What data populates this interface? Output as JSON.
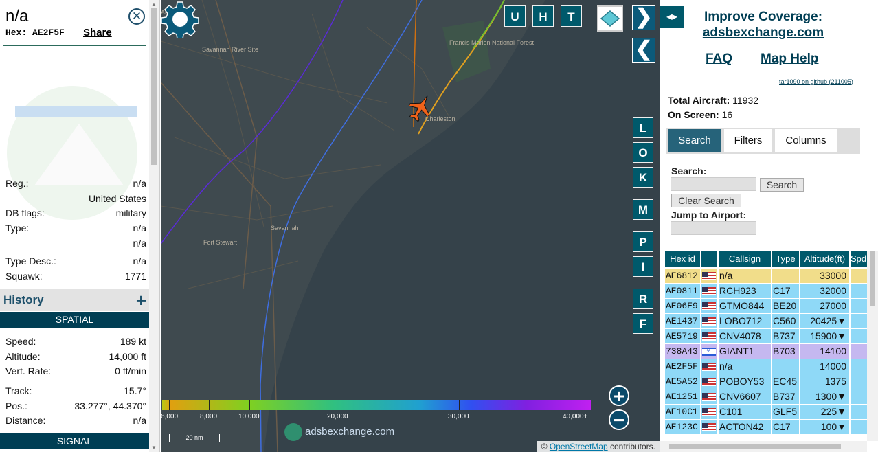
{
  "selected": {
    "callsign": "n/a",
    "hex_label": "Hex:",
    "hex": "AE2F5F",
    "share": "Share",
    "close_icon": "close-icon",
    "details": [
      {
        "key": "Reg.:",
        "value": "n/a"
      },
      {
        "key": "",
        "value": "United States"
      },
      {
        "key": "DB flags:",
        "value": "military"
      },
      {
        "key": "Type:",
        "value": "n/a"
      },
      {
        "key": "",
        "value": "n/a"
      },
      {
        "key": "Type Desc.:",
        "value": "n/a"
      },
      {
        "key": "Squawk:",
        "value": "1771"
      }
    ],
    "history_label": "History",
    "history_plus": "+",
    "spatial_label": "SPATIAL",
    "spatial": [
      {
        "key": "Speed:",
        "value": "189 kt"
      },
      {
        "key": "Altitude:",
        "value": "14,000 ft"
      },
      {
        "key": "Vert. Rate:",
        "value": "0 ft/min"
      },
      {
        "key": "Track:",
        "value": "15.7°"
      },
      {
        "key": "Pos.:",
        "value": "33.277°, 44.370°"
      },
      {
        "key": "Distance:",
        "value": "n/a"
      }
    ],
    "signal_label": "SIGNAL"
  },
  "map": {
    "places": [
      "Augusta",
      "Savannah River Site",
      "Francis Marion National Forest",
      "Charleston",
      "Savannah",
      "Fort Stewart"
    ],
    "view_buttons": [
      "U",
      "H",
      "T"
    ],
    "side_buttons": [
      "L",
      "O",
      "K",
      "M",
      "P",
      "I",
      "R",
      "F"
    ],
    "next_label": "❯",
    "prev_label": "❮",
    "zoom_in": "+",
    "zoom_out": "−",
    "legend_labels": [
      "6,000",
      "8,000",
      "10,000",
      "20,000",
      "30,000",
      "40,000+"
    ],
    "scale": "20 nm",
    "watermark": "adsbexchange.com",
    "attribution_prefix": "©",
    "attribution_link": "OpenStreetMap",
    "attribution_suffix": "contributors."
  },
  "sidebar": {
    "toggle": "◂▸",
    "coverage_line1": "Improve Coverage:",
    "coverage_site": "adsbexchange.com",
    "faq": "FAQ",
    "map_help": "Map Help",
    "version": "tar1090 on github (211005)",
    "total_label": "Total Aircraft:",
    "total_value": "11932",
    "onscreen_label": "On Screen:",
    "onscreen_value": "16",
    "tabs": [
      "Search",
      "Filters",
      "Columns"
    ],
    "search_label": "Search:",
    "search_button": "Search",
    "clear_button": "Clear Search",
    "jump_label": "Jump to Airport:"
  },
  "table": {
    "headers": [
      "Hex id",
      "",
      "Callsign",
      "Type",
      "Altitude(ft)",
      "Spd"
    ],
    "rows": [
      {
        "hex": "AE6812",
        "flag": "us",
        "callsign": "n/a",
        "type": "",
        "alt": "33000",
        "color": "#f1dd8a"
      },
      {
        "hex": "AE0811",
        "flag": "us",
        "callsign": "RCH923",
        "type": "C17",
        "alt": "32000",
        "color": "#8fd9f7"
      },
      {
        "hex": "AE06E9",
        "flag": "us",
        "callsign": "GTMO844",
        "type": "BE20",
        "alt": "27000",
        "color": "#8fd9f7"
      },
      {
        "hex": "AE1437",
        "flag": "us",
        "callsign": "LOBO712",
        "type": "C560",
        "alt": "20425▼",
        "color": "#8fd9f7"
      },
      {
        "hex": "AE5719",
        "flag": "us",
        "callsign": "CNV4078",
        "type": "B737",
        "alt": "15900▼",
        "color": "#8fd9f7"
      },
      {
        "hex": "738A43",
        "flag": "il",
        "callsign": "GIANT1",
        "type": "B703",
        "alt": "14100",
        "color": "#c5b8f0"
      },
      {
        "hex": "AE2F5F",
        "flag": "us",
        "callsign": "n/a",
        "type": "",
        "alt": "14000",
        "color": "#8fd9f7"
      },
      {
        "hex": "AE5A52",
        "flag": "us",
        "callsign": "POBOY53",
        "type": "EC45",
        "alt": "1375",
        "color": "#8fd9f7"
      },
      {
        "hex": "AE1251",
        "flag": "us",
        "callsign": "CNV6607",
        "type": "B737",
        "alt": "1300▼",
        "color": "#8fd9f7"
      },
      {
        "hex": "AE10C1",
        "flag": "us",
        "callsign": "C101",
        "type": "GLF5",
        "alt": "225▼",
        "color": "#8fd9f7"
      },
      {
        "hex": "AE123C",
        "flag": "us",
        "callsign": "ACTON42",
        "type": "C17",
        "alt": "100▼",
        "color": "#8fd9f7"
      }
    ]
  }
}
